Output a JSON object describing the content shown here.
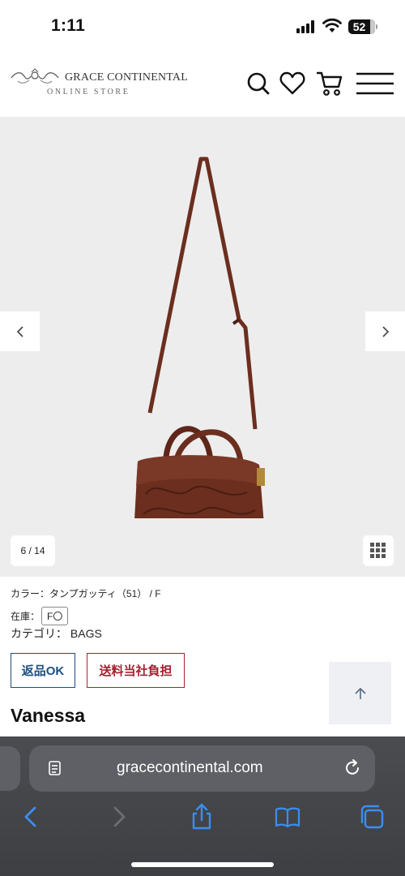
{
  "status_bar": {
    "time": "1:11",
    "battery_level": "52",
    "icons": [
      "signal-icon",
      "wifi-icon",
      "battery-icon"
    ]
  },
  "header": {
    "logo_main": "GRACE CONTINENTAL",
    "logo_sub": "ONLINE STORE",
    "icons": [
      "search-icon",
      "heart-icon",
      "cart-icon",
      "menu-icon"
    ]
  },
  "gallery": {
    "counter": "6 / 14",
    "current_image": 6,
    "total_images": 14
  },
  "product": {
    "color_line": "カラー：タンプガッティ（51）  /  F",
    "stock_label": "在庫：",
    "stock_value": "F〇",
    "category_line": "カテゴリ： BAGS",
    "badge_return": "返品OK",
    "badge_shipping": "送料当社負担",
    "name": "Vanessa"
  },
  "browser": {
    "url": "gracecontinental.com",
    "toolbar_icons": [
      "back-icon",
      "forward-icon",
      "share-icon",
      "bookmarks-icon",
      "tabs-icon"
    ]
  },
  "colors": {
    "accent_blue": "#1c4f80",
    "accent_red": "#a62030",
    "safari_blue": "#3b8ef0",
    "gallery_bg": "#ededed",
    "bag_brown": "#6b2e1f"
  }
}
